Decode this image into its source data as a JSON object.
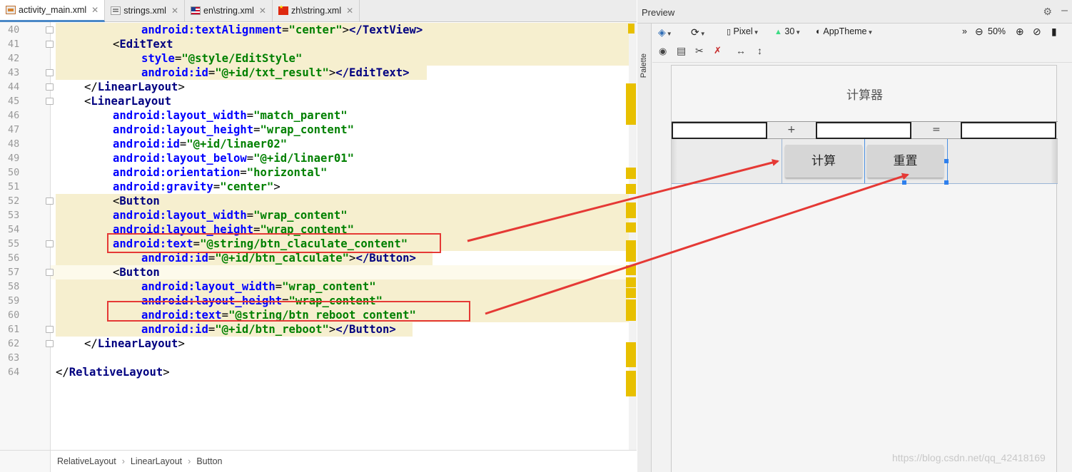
{
  "editor": {
    "tabs": [
      {
        "label": "activity_main.xml",
        "icon": "xml-file-icon",
        "active": true
      },
      {
        "label": "strings.xml",
        "icon": "strings-file-icon",
        "active": false
      },
      {
        "label": "en\\string.xml",
        "icon": "us-flag-icon",
        "active": false
      },
      {
        "label": "zh\\string.xml",
        "icon": "cn-flag-icon",
        "active": false
      }
    ],
    "lines": [
      {
        "n": "40",
        "parts": [
          [
            "a",
            "android:textAlignment"
          ],
          [
            "p",
            "="
          ],
          [
            "v",
            "\"center\""
          ],
          [
            "p",
            ">"
          ],
          [
            "t",
            "</TextView>"
          ]
        ]
      },
      {
        "n": "41",
        "parts": [
          [
            "p",
            "<"
          ],
          [
            "t",
            "EditText"
          ]
        ]
      },
      {
        "n": "42",
        "parts": [
          [
            "a",
            "style"
          ],
          [
            "p",
            "="
          ],
          [
            "v",
            "\"@style/EditStyle\""
          ]
        ]
      },
      {
        "n": "43",
        "parts": [
          [
            "a",
            "android:id"
          ],
          [
            "p",
            "="
          ],
          [
            "v",
            "\"@+id/txt_result\""
          ],
          [
            "p",
            ">"
          ],
          [
            "t",
            "</EditText>"
          ]
        ]
      },
      {
        "n": "44",
        "parts": [
          [
            "p",
            "</"
          ],
          [
            "t",
            "LinearLayout"
          ],
          [
            "p",
            ">"
          ]
        ]
      },
      {
        "n": "45",
        "parts": [
          [
            "p",
            "<"
          ],
          [
            "t",
            "LinearLayout"
          ]
        ]
      },
      {
        "n": "46",
        "parts": [
          [
            "a",
            "android:layout_width"
          ],
          [
            "p",
            "="
          ],
          [
            "v",
            "\"match_parent\""
          ]
        ]
      },
      {
        "n": "47",
        "parts": [
          [
            "a",
            "android:layout_height"
          ],
          [
            "p",
            "="
          ],
          [
            "v",
            "\"wrap_content\""
          ]
        ]
      },
      {
        "n": "48",
        "parts": [
          [
            "a",
            "android:id"
          ],
          [
            "p",
            "="
          ],
          [
            "v",
            "\"@+id/linaer02\""
          ]
        ]
      },
      {
        "n": "49",
        "parts": [
          [
            "a",
            "android:layout_below"
          ],
          [
            "p",
            "="
          ],
          [
            "v",
            "\"@+id/linaer01\""
          ]
        ]
      },
      {
        "n": "50",
        "parts": [
          [
            "a",
            "android:orientation"
          ],
          [
            "p",
            "="
          ],
          [
            "v",
            "\"horizontal\""
          ]
        ]
      },
      {
        "n": "51",
        "parts": [
          [
            "a",
            "android:gravity"
          ],
          [
            "p",
            "="
          ],
          [
            "v",
            "\"center\""
          ],
          [
            "p",
            ">"
          ]
        ]
      },
      {
        "n": "52",
        "parts": [
          [
            "p",
            "<"
          ],
          [
            "t",
            "Button"
          ]
        ]
      },
      {
        "n": "53",
        "parts": [
          [
            "a",
            "android:layout_width"
          ],
          [
            "p",
            "="
          ],
          [
            "v",
            "\"wrap_content\""
          ]
        ]
      },
      {
        "n": "54",
        "parts": [
          [
            "a",
            "android:layout_height"
          ],
          [
            "p",
            "="
          ],
          [
            "v",
            "\"wrap_content\""
          ]
        ]
      },
      {
        "n": "55",
        "parts": [
          [
            "a",
            "android:text"
          ],
          [
            "p",
            "="
          ],
          [
            "v",
            "\"@string/btn_claculate_content\""
          ]
        ]
      },
      {
        "n": "56",
        "parts": [
          [
            "a",
            "android:id"
          ],
          [
            "p",
            "="
          ],
          [
            "v",
            "\"@+id/btn_calculate\""
          ],
          [
            "p",
            ">"
          ],
          [
            "t",
            "</Button>"
          ]
        ]
      },
      {
        "n": "57",
        "parts": [
          [
            "p",
            "<"
          ],
          [
            "t",
            "Button"
          ]
        ]
      },
      {
        "n": "58",
        "parts": [
          [
            "a",
            "android:layout_width"
          ],
          [
            "p",
            "="
          ],
          [
            "v",
            "\"wrap_content\""
          ]
        ]
      },
      {
        "n": "59",
        "parts": [
          [
            "a",
            "android:layout_height"
          ],
          [
            "p",
            "="
          ],
          [
            "v",
            "\"wrap_content\""
          ]
        ]
      },
      {
        "n": "60",
        "parts": [
          [
            "a",
            "android:text"
          ],
          [
            "p",
            "="
          ],
          [
            "v",
            "\"@string/btn_reboot_content\""
          ]
        ]
      },
      {
        "n": "61",
        "parts": [
          [
            "a",
            "android:id"
          ],
          [
            "p",
            "="
          ],
          [
            "v",
            "\"@+id/btn_reboot\""
          ],
          [
            "p",
            ">"
          ],
          [
            "t",
            "</Button>"
          ]
        ]
      },
      {
        "n": "62",
        "parts": [
          [
            "p",
            "</"
          ],
          [
            "t",
            "LinearLayout"
          ],
          [
            "p",
            ">"
          ]
        ]
      },
      {
        "n": "63",
        "parts": []
      },
      {
        "n": "64",
        "parts": [
          [
            "p",
            "</"
          ],
          [
            "t",
            "RelativeLayout"
          ],
          [
            "p",
            ">"
          ]
        ]
      }
    ],
    "breadcrumb": [
      "RelativeLayout",
      "LinearLayout",
      "Button"
    ]
  },
  "preview": {
    "title": "Preview",
    "palette_label": "Palette",
    "device": "Pixel",
    "api": "30",
    "theme": "AppTheme",
    "zoom": "50%",
    "app": {
      "title": "计算器",
      "plus": "+",
      "equals": "=",
      "btn_calculate": "计算",
      "btn_reboot": "重置"
    }
  },
  "watermark": "https://blog.csdn.net/qq_42418169",
  "colors": {
    "annotation_red": "#e53935",
    "xml_tag": "#000080",
    "xml_attr": "#0000ff",
    "xml_value": "#008000",
    "highlight": "#f6efcf"
  }
}
